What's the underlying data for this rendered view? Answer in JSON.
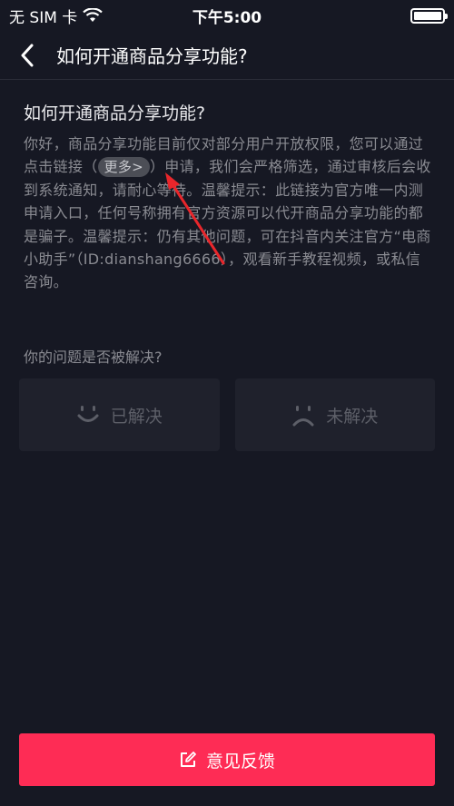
{
  "status_bar": {
    "carrier": "无 SIM 卡",
    "time": "下午5:00"
  },
  "nav": {
    "title": "如何开通商品分享功能?"
  },
  "question": {
    "title": "如何开通商品分享功能?",
    "answer_part1": "你好，商品分享功能目前仅对部分用户开放权限，您可以通过点击链接（",
    "more_link": "更多>",
    "answer_part2": "）申请，我们会严格筛选，通过审核后会收到系统通知，请耐心等待。温馨提示：此链接为官方唯一内测申请入口，任何号称拥有官方资源可以代开商品分享功能的都是骗子。温馨提示：仍有其他问题，可在抖音内关注官方“电商小助手”（ID:dianshang6666），观看新手教程视频，或私信咨询。"
  },
  "resolution": {
    "question": "你的问题是否被解决?",
    "resolved_label": "已解决",
    "unresolved_label": "未解决"
  },
  "feedback": {
    "label": "意见反馈"
  },
  "colors": {
    "background": "#161823",
    "accent": "#fe2c55",
    "annotation_arrow": "#e8262b"
  },
  "icons": [
    "wifi-icon",
    "battery-icon",
    "back-arrow-icon",
    "smile-icon",
    "frown-icon",
    "edit-icon"
  ]
}
